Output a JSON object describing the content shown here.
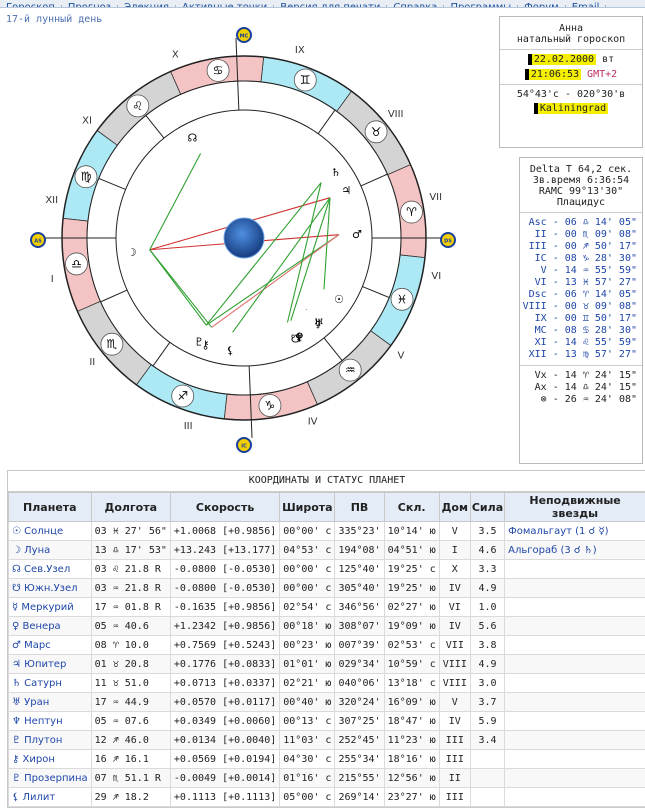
{
  "nav": [
    "Гороскоп",
    "Прогноз",
    "Элекция",
    "Активные точки",
    "Версия для печати",
    "Справка",
    "Программы",
    "Форум",
    "Email"
  ],
  "lunar_day": "17-й лунный день",
  "info": {
    "name": "Анна",
    "type": "натальный гороскоп",
    "date": "22.02.2000",
    "weekday": "вт",
    "time": "21:06:53",
    "tz": "GMT+2",
    "coords": "54°43'с - 020°30'в",
    "city": "Kaliningrad"
  },
  "params": {
    "delta_t": "Delta T  64,2 сек.",
    "star_time": "Зв.время 6:36:54",
    "ramc": "RAMC 99°13'30\"",
    "system": "Плацидус"
  },
  "cusps": [
    "Asc - 06 ♎ 14' 05\"",
    "II - 00 ♏ 09' 08\"",
    "III - 00 ♐ 50' 17\"",
    "IC - 08 ♑ 28' 30\"",
    "V - 14 ♒ 55' 59\"",
    "VI - 13 ♓ 57' 27\"",
    "Dsc - 06 ♈ 14' 05\"",
    "VIII - 00 ♉ 09' 08\"",
    "IX - 00 ♊ 50' 17\"",
    "MC - 08 ♋ 28' 30\"",
    "XI - 14 ♌ 55' 59\"",
    "XII - 13 ♍ 57' 27\""
  ],
  "points": [
    "Vx - 14 ♈ 24' 15\"",
    "Ax - 14 ♎ 24' 15\"",
    "⊗ - 26 ♒ 24' 08\""
  ],
  "wheel": {
    "houses": [
      "I",
      "II",
      "III",
      "IV",
      "V",
      "VI",
      "VII",
      "VIII",
      "IX",
      "X",
      "XI",
      "XII"
    ],
    "markers": {
      "mc": "MC",
      "ic": "IC",
      "as": "AS",
      "ds": "DS"
    }
  },
  "table": {
    "title": "КООРДИНАТЫ И СТАТУС ПЛАНЕТ",
    "headers": [
      "Планета",
      "Долгота",
      "Скорость",
      "Широта",
      "ПВ",
      "Скл.",
      "Дом",
      "Сила",
      "Неподвижные звезды"
    ],
    "rows": [
      [
        "☉ Солнце",
        "03 ♓ 27' 56\"",
        "+1.0068 [+0.9856]",
        "00°00' с",
        "335°23'",
        "10°14' ю",
        "V",
        "3.5",
        "Фомальгаут (1 ☌ ☿)"
      ],
      [
        "☽ Луна",
        "13 ♎ 17' 53\"",
        "+13.243 [+13.177]",
        "04°53' с",
        "194°08'",
        "04°51' ю",
        "I",
        "4.6",
        "Альгораб (3 ☌ ♄)"
      ],
      [
        "☊ Сев.Узел",
        "03 ♌ 21.8 R",
        "-0.0800 [-0.0530]",
        "00°00' с",
        "125°40'",
        "19°25' с",
        "X",
        "3.3",
        ""
      ],
      [
        "☋ Южн.Узел",
        "03 ♒ 21.8 R",
        "-0.0800 [-0.0530]",
        "00°00' с",
        "305°40'",
        "19°25' ю",
        "IV",
        "4.9",
        ""
      ],
      [
        "☿ Меркурий",
        "17 ♒ 01.8 R",
        "-0.1635 [+0.9856]",
        "02°54' с",
        "346°56'",
        "02°27' ю",
        "VI",
        "1.0",
        ""
      ],
      [
        "♀ Венера",
        "05 ♒ 40.6",
        "+1.2342 [+0.9856]",
        "00°18' ю",
        "308°07'",
        "19°09' ю",
        "IV",
        "5.6",
        ""
      ],
      [
        "♂ Марс",
        "08 ♈ 10.0",
        "+0.7569 [+0.5243]",
        "00°23' ю",
        "007°39'",
        "02°53' с",
        "VII",
        "3.8",
        ""
      ],
      [
        "♃ Юпитер",
        "01 ♉ 20.8",
        "+0.1776 [+0.0833]",
        "01°01' ю",
        "029°34'",
        "10°59' с",
        "VIII",
        "4.9",
        ""
      ],
      [
        "♄ Сатурн",
        "11 ♉ 51.0",
        "+0.0713 [+0.0337]",
        "02°21' ю",
        "040°06'",
        "13°18' с",
        "VIII",
        "3.0",
        ""
      ],
      [
        "♅ Уран",
        "17 ♒ 44.9",
        "+0.0570 [+0.0117]",
        "00°40' ю",
        "320°24'",
        "16°09' ю",
        "V",
        "3.7",
        ""
      ],
      [
        "♆ Нептун",
        "05 ♒ 07.6",
        "+0.0349 [+0.0060]",
        "00°13' с",
        "307°25'",
        "18°47' ю",
        "IV",
        "5.9",
        ""
      ],
      [
        "♇ Плутон",
        "12 ♐ 46.0",
        "+0.0134 [+0.0040]",
        "11°03' с",
        "252°45'",
        "11°23' ю",
        "III",
        "3.4",
        ""
      ],
      [
        "⚷ Хирон",
        "16 ♐ 16.1",
        "+0.0569 [+0.0194]",
        "04°30' с",
        "255°34'",
        "18°16' ю",
        "III",
        "",
        ""
      ],
      [
        "♇ Прозерпина",
        "07 ♏ 51.1 R",
        "-0.0049 [+0.0014]",
        "01°16' с",
        "215°55'",
        "12°56' ю",
        "II",
        "",
        ""
      ],
      [
        "⚸ Лилит",
        "29 ♐ 18.2",
        "+0.1113 [+0.1113]",
        "05°00' с",
        "269°14'",
        "23°27' ю",
        "III",
        "",
        ""
      ]
    ]
  }
}
